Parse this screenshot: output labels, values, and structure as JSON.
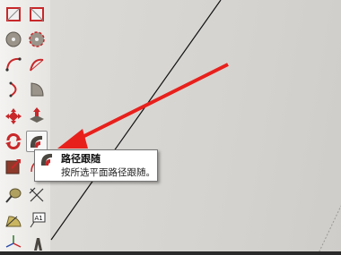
{
  "toolbar": {
    "tools": [
      {
        "id": "rectangle",
        "icon": "rectangle-icon"
      },
      {
        "id": "rotated-rectangle",
        "icon": "rotated-rectangle-icon"
      },
      {
        "id": "circle",
        "icon": "circle-icon"
      },
      {
        "id": "polygon",
        "icon": "polygon-icon"
      },
      {
        "id": "arc",
        "icon": "arc-icon"
      },
      {
        "id": "two-point-arc",
        "icon": "two-point-arc-icon"
      },
      {
        "id": "three-point-arc",
        "icon": "three-point-arc-icon"
      },
      {
        "id": "pie",
        "icon": "pie-icon"
      },
      {
        "id": "move",
        "icon": "move-icon"
      },
      {
        "id": "push-pull",
        "icon": "push-pull-icon"
      },
      {
        "id": "rotate",
        "icon": "rotate-icon"
      },
      {
        "id": "follow-me",
        "icon": "follow-me-icon",
        "active": true
      },
      {
        "id": "scale",
        "icon": "scale-icon"
      },
      {
        "id": "offset",
        "icon": "offset-icon"
      },
      {
        "id": "tape-measure",
        "icon": "tape-measure-icon"
      },
      {
        "id": "dimension",
        "icon": "dimension-icon"
      },
      {
        "id": "protractor",
        "icon": "protractor-icon"
      },
      {
        "id": "text",
        "icon": "text-icon",
        "label": "A1"
      },
      {
        "id": "axes",
        "icon": "axes-icon"
      },
      {
        "id": "3d-text",
        "icon": "3d-text-icon"
      }
    ]
  },
  "tooltip": {
    "title": "路径跟随",
    "description": "按所选平面路径跟随。",
    "icon": "follow-me-icon"
  },
  "colors": {
    "arrow": "#e8201c",
    "canvas": "#d5d3cf",
    "tool_red": "#c8282a"
  }
}
